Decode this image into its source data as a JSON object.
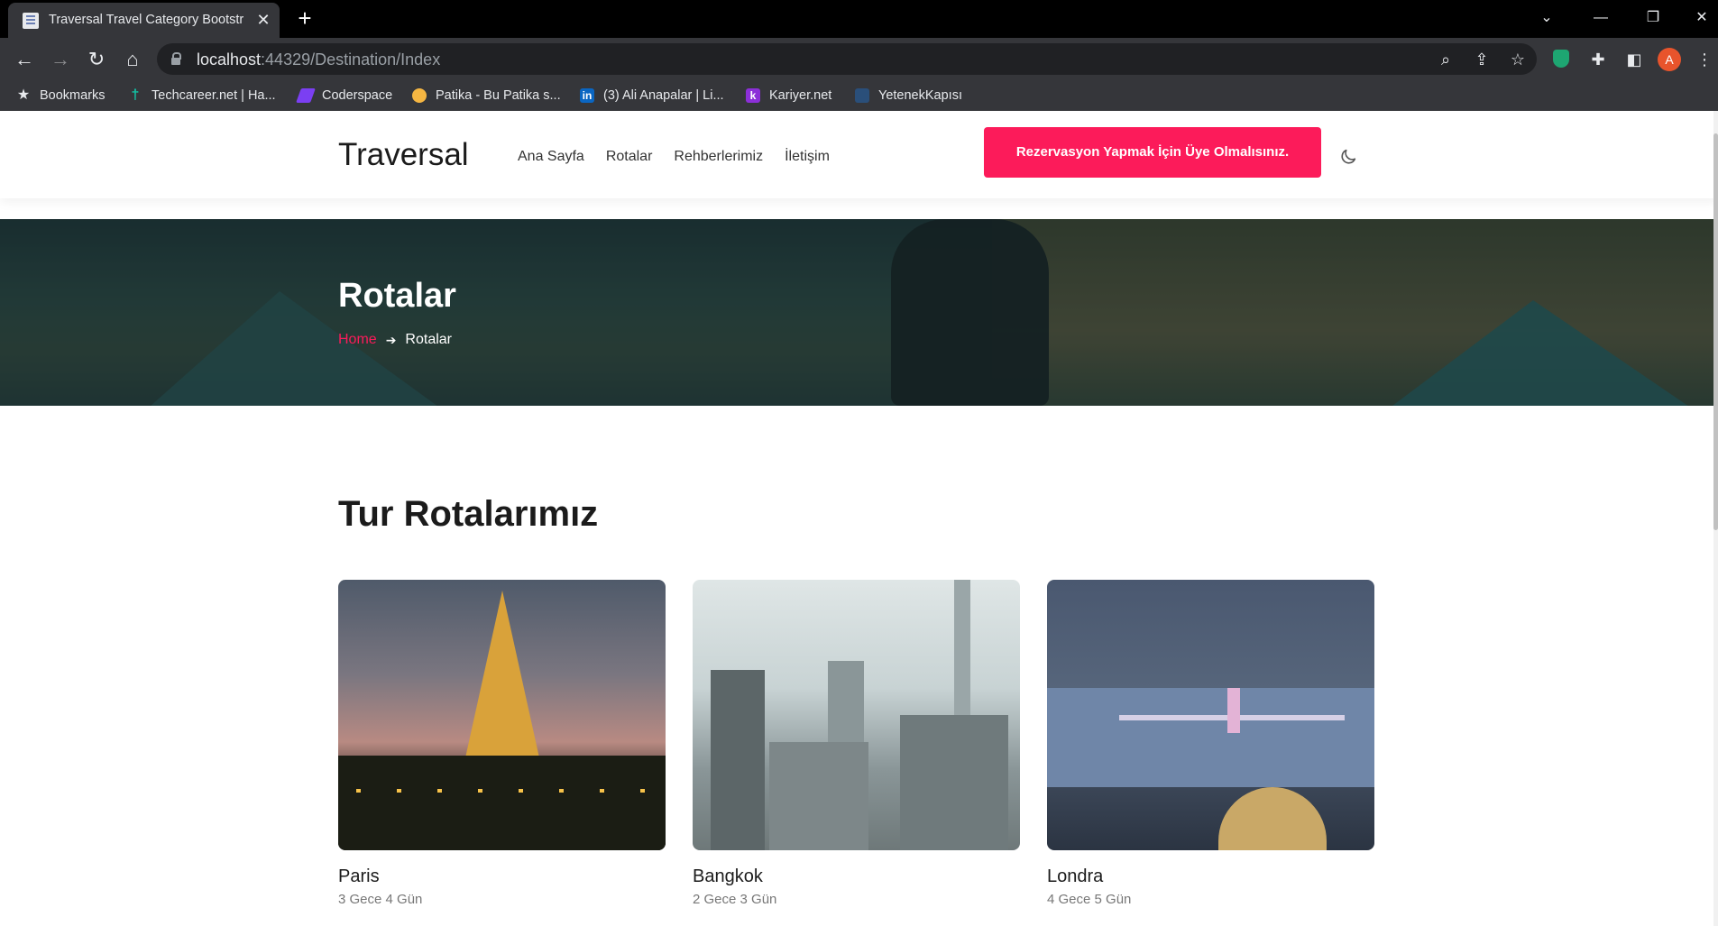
{
  "browser": {
    "tab_title": "Traversal Travel Category Bootstr",
    "url_host": "localhost",
    "url_rest": ":44329/Destination/Index",
    "profile_initial": "A",
    "bookmarks": [
      {
        "label": "Bookmarks",
        "icon": "star-icon",
        "color": "#e8eaed"
      },
      {
        "label": "Techcareer.net | Ha...",
        "icon": "techcareer-icon",
        "color": "#12c4a6"
      },
      {
        "label": "Coderspace",
        "icon": "coderspace-icon",
        "color": "#7b3ff2"
      },
      {
        "label": "Patika - Bu Patika s...",
        "icon": "patika-icon",
        "color": "#f5b642"
      },
      {
        "label": "(3) Ali Anapalar | Li...",
        "icon": "linkedin-icon",
        "color": "#0a66c2"
      },
      {
        "label": "Kariyer.net",
        "icon": "kariyer-icon",
        "color": "#8c2fd8"
      },
      {
        "label": "YetenekKapısı",
        "icon": "yetenekkapisi-icon",
        "color": "#2a4f7a"
      }
    ]
  },
  "site": {
    "brand": "Traversal",
    "menu": [
      "Ana Sayfa",
      "Rotalar",
      "Rehberlerimiz",
      "İletişim"
    ],
    "cta_label": "Rezervasyon Yapmak İçin Üye Olmalısınız.",
    "accent_color": "#fc1b5a"
  },
  "hero": {
    "title": "Rotalar",
    "breadcrumb_home": "Home",
    "breadcrumb_current": "Rotalar"
  },
  "section": {
    "title": "Tur Rotalarımız"
  },
  "destinations": [
    {
      "name": "Paris",
      "duration": "3 Gece 4 Gün"
    },
    {
      "name": "Bangkok",
      "duration": "2 Gece 3 Gün"
    },
    {
      "name": "Londra",
      "duration": "4 Gece 5 Gün"
    }
  ]
}
